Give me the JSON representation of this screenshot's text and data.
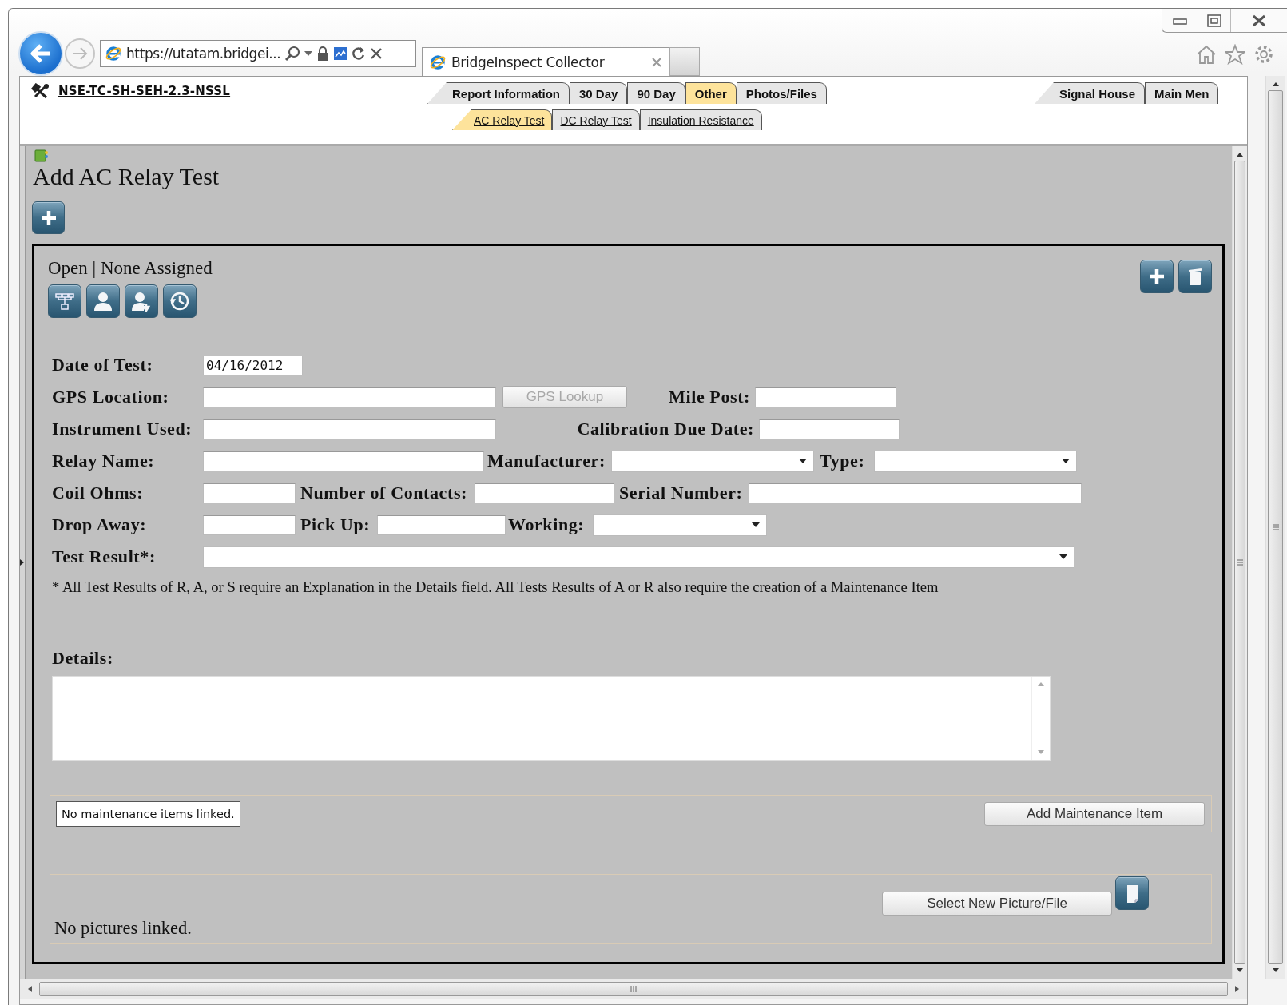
{
  "browser": {
    "address": "https://utatam.bridgei...",
    "tab_title": "BridgeInspect Collector"
  },
  "app": {
    "record_link": "NSE-TC-SH-SEH-2.3-NSSL",
    "main_tabs": [
      {
        "label": "Report Information",
        "selected": false
      },
      {
        "label": "30 Day",
        "selected": false
      },
      {
        "label": "90 Day",
        "selected": false
      },
      {
        "label": "Other",
        "selected": true
      },
      {
        "label": "Photos/Files",
        "selected": false
      }
    ],
    "nav_tabs": [
      {
        "label": "Signal House",
        "selected": false
      },
      {
        "label": "Main Men",
        "selected": false
      }
    ],
    "sub_tabs": [
      {
        "label": "AC Relay Test",
        "selected": true
      },
      {
        "label": "DC Relay Test",
        "selected": false
      },
      {
        "label": "Insulation Resistance",
        "selected": false
      }
    ]
  },
  "heading": "Add AC Relay Test",
  "record": {
    "status": "Open | None Assigned"
  },
  "form": {
    "lines": [
      {
        "fields": [
          {
            "label": "Date of Test:",
            "kind": "input",
            "value": "04/16/2012"
          }
        ]
      },
      {
        "fields": [
          {
            "label": "GPS Location:",
            "kind": "input",
            "button": {
              "text": "GPS Lookup",
              "disabled": true
            }
          },
          {
            "label": "Mile Post:",
            "kind": "input"
          }
        ]
      },
      {
        "fields": [
          {
            "label": "Instrument Used:",
            "kind": "input"
          },
          {
            "label": "Calibration Due Date:",
            "kind": "input"
          }
        ]
      },
      {
        "fields": [
          {
            "label": "Relay Name:",
            "kind": "input"
          },
          {
            "label": "Manufacturer:",
            "kind": "select"
          },
          {
            "label": "Type:",
            "kind": "select"
          }
        ]
      },
      {
        "fields": [
          {
            "label": "Coil Ohms:",
            "kind": "input"
          },
          {
            "label": "Number of Contacts:",
            "kind": "input"
          },
          {
            "label": "Serial Number:",
            "kind": "input"
          }
        ]
      },
      {
        "fields": [
          {
            "label": "Drop Away:",
            "kind": "input"
          },
          {
            "label": "Pick Up:",
            "kind": "input"
          },
          {
            "label": "Working:",
            "kind": "select"
          }
        ]
      },
      {
        "fields": [
          {
            "label": "Test Result*:",
            "kind": "select"
          }
        ]
      }
    ],
    "note": "* All Test Results of R, A, or S require an Explanation in the Details field. All Tests Results of A or R also require the creation of a Maintenance Item",
    "details_label": "Details:"
  },
  "maintenance": {
    "message": "No maintenance items linked.",
    "button": "Add Maintenance Item"
  },
  "pictures": {
    "message": "No pictures linked.",
    "button": "Select New Picture/File"
  }
}
